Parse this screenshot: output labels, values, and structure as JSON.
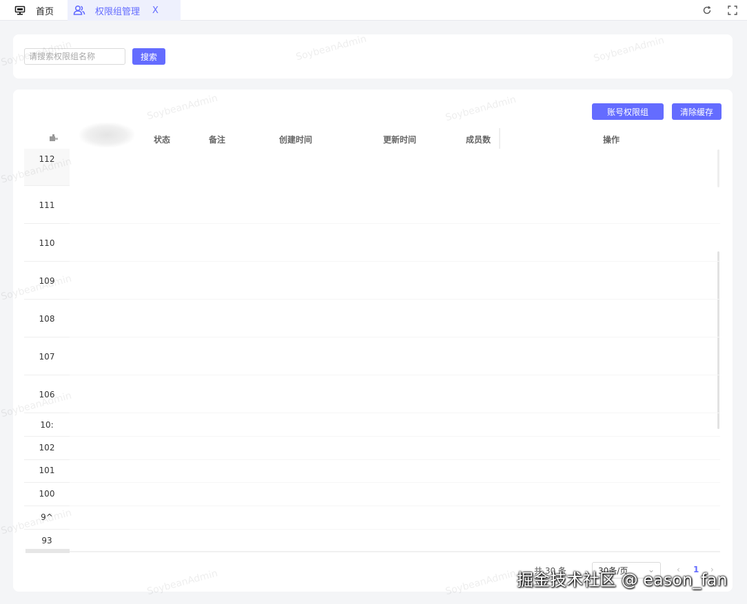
{
  "tabs": {
    "home_label": "首页",
    "active_label": "权限组管理",
    "close_glyph": "X"
  },
  "search": {
    "placeholder": "请搜索权限组名称",
    "button": "搜索"
  },
  "toolbar": {
    "account_group_button": "账号权限组",
    "clear_cache_button": "清除缓存"
  },
  "table": {
    "columns": [
      "状态",
      "备注",
      "创建时间",
      "更新时间",
      "成员数",
      "操作"
    ],
    "row_ids": [
      "112",
      "111",
      "110",
      "109",
      "108",
      "107",
      "106",
      "10:",
      "102",
      "101",
      "100",
      "9^",
      "93"
    ]
  },
  "pagination": {
    "total": "共 30 条",
    "page_size": "30条/页",
    "current_page": "1",
    "prev": "‹",
    "next": "›"
  },
  "watermark": "SoybeanAdmin",
  "footer_overlay": "掘金技术社区 @ eason_fan",
  "colors": {
    "primary": "#646cff"
  }
}
